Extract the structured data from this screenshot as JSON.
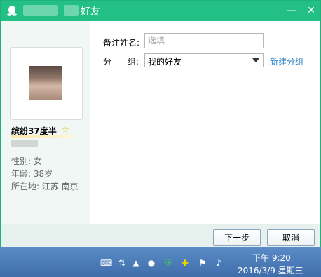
{
  "window": {
    "title": "好友"
  },
  "profile": {
    "nickname": "缤纷37度半",
    "gender_line": "性别: 女",
    "age_line": "年龄: 38岁",
    "location_line": "所在地: 江苏 南京"
  },
  "form": {
    "remark_label": "备注姓名:",
    "remark_placeholder": "选填",
    "remark_value": "",
    "group_label": "分      组:",
    "group_value": "我的好友",
    "new_group_link": "新建分组"
  },
  "buttons": {
    "next": "下一步",
    "cancel": "取消"
  },
  "taskbar": {
    "time": "下午 9:20",
    "date": "2016/3/9 星期三"
  },
  "colors": {
    "titlebar": "#22bf86",
    "link": "#2e84c7",
    "star": "#f2b705"
  }
}
